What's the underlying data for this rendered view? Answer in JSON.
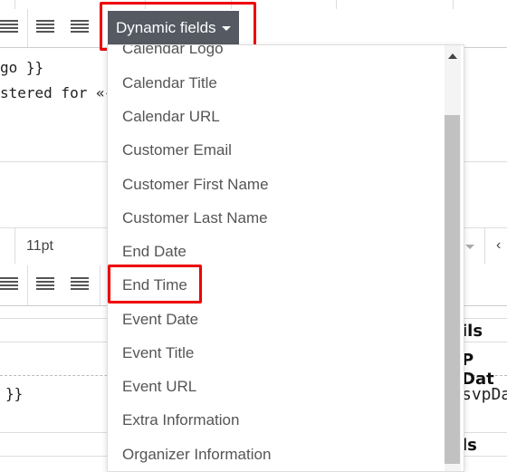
{
  "toolbar": {
    "dynamic_fields_label": "Dynamic fields",
    "font_size": "11pt"
  },
  "editor": {
    "line1": "go }}",
    "line2": "stered for «{{",
    "line3": "}}"
  },
  "right_table": {
    "cell1": "ils",
    "cell2": "P Dat",
    "cell3": "svpDa",
    "cell4": "ls"
  },
  "menu": {
    "items": [
      "Calendar Logo",
      "Calendar Title",
      "Calendar URL",
      "Customer Email",
      "Customer First Name",
      "Customer Last Name",
      "End Date",
      "End Time",
      "Event Date",
      "Event Title",
      "Event URL",
      "Extra Information",
      "Organizer Information"
    ],
    "highlighted": "End Time"
  },
  "colors": {
    "button_bg": "#555a62",
    "highlight": "#e00000"
  }
}
